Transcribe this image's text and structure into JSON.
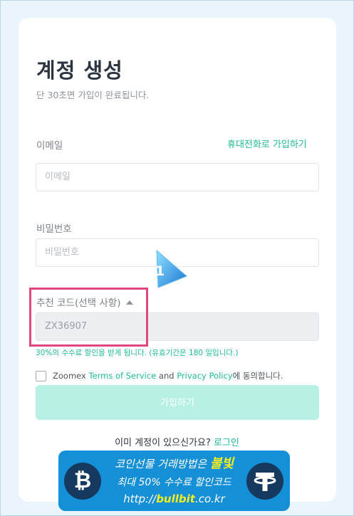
{
  "header": {
    "title": "계정 생성",
    "subtitle": "단 30초면 가입이 완료됩니다."
  },
  "email": {
    "label": "이메일",
    "switch_link": "휴대전화로 가입하기",
    "placeholder": "이메일"
  },
  "password": {
    "label": "비밀번호",
    "placeholder": "비밀번호"
  },
  "referral": {
    "label": "추천 코드(선택 사항)",
    "value": "ZX36907",
    "note": "30%의 수수료 할인을 받게 됩니다. (유효기간은 180 일입니다.)"
  },
  "annotation": {
    "badge_number": "1"
  },
  "terms": {
    "prefix": "Zoomex ",
    "tos_link": "Terms of Service",
    "and": " and ",
    "privacy_link": "Privacy Policy",
    "suffix": "에 동의합니다."
  },
  "submit": {
    "label": "가입하기"
  },
  "login": {
    "prompt": "이미 계정이 있으신가요? ",
    "link": "로그인"
  },
  "banner": {
    "line1_prefix": "코인선물 거래방법은 ",
    "line1_highlight": "불빛",
    "line2": "최대 50% 수수료 할인코드",
    "line3_prefix": "http://",
    "line3_highlight": "bullbit",
    "line3_suffix": ".co.kr",
    "left_icon": "bitcoin-icon",
    "right_icon": "tether-icon"
  },
  "colors": {
    "accent": "#1fb896",
    "button_disabled": "#b6f1e4",
    "highlight_box": "#e0477f",
    "banner_bg": "#1590d6",
    "banner_highlight": "#f5ee1f"
  }
}
